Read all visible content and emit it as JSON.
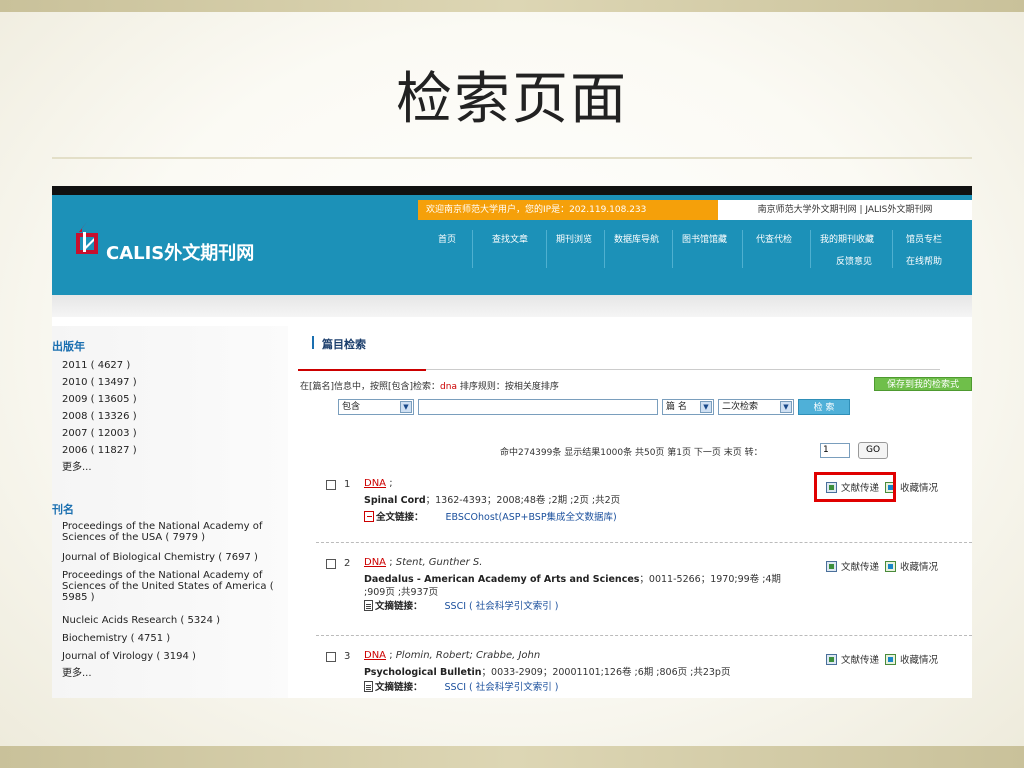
{
  "slide": {
    "title": "检索页面"
  },
  "header": {
    "welcome": "欢迎南京师范大学用户，您的IP是：202.119.108.233",
    "site_name": "南京师范大学外文期刊网 | JALIS外文期刊网",
    "logo_text": "CALIS外文期刊网",
    "nav": [
      "首页",
      "查找文章",
      "期刊浏览",
      "数据库导航",
      "图书馆馆藏",
      "代查代检",
      "我的期刊收藏",
      "馆员专栏"
    ],
    "nav_row2": [
      "反馈意见",
      "在线帮助"
    ]
  },
  "sidebar": {
    "year_heading": "出版年",
    "years": [
      "2011 ( 4627 )",
      "2010 ( 13497 )",
      "2009 ( 13605 )",
      "2008 ( 13326 )",
      "2007 ( 12003 )",
      "2006 ( 11827 )"
    ],
    "years_more": "更多...",
    "journal_heading": "刊名",
    "journals": [
      "Proceedings of the National Academy of Sciences of the USA ( 7979 )",
      "Journal of Biological Chemistry ( 7697 )",
      "Proceedings of the National Academy of Sciences of the United States of America ( 5985 )",
      "Nucleic Acids Research ( 5324 )",
      "Biochemistry ( 4751 )",
      "Journal of Virology ( 3194 )"
    ],
    "journals_more": "更多..."
  },
  "main": {
    "section_title": "篇目检索",
    "info_prefix": "在[篇名]信息中，按照[包含]检索：",
    "keyword": "dna",
    "info_suffix": " 排序规则：按相关度排序",
    "save_button": "保存到我的检索式",
    "match_select": "包含",
    "field_select": "篇 名",
    "secondary_select": "二次检索",
    "search_button": "检 索",
    "stats": "命中274399条 显示结果1000条 共50页 第1页 下一页 末页 转：",
    "page_input": "1",
    "go_button": "GO"
  },
  "results": [
    {
      "num": "1",
      "title": "DNA",
      "authors": "",
      "journal": "Spinal Cord",
      "details": "；1362-4393；2008;48卷 ;2期 ;2页 ;共2页",
      "details2": "",
      "link_label": "全文链接：",
      "link_source": "EBSCOhost(ASP+BSP集成全文数据库)",
      "action1": "文献传递",
      "action2": "收藏情况"
    },
    {
      "num": "2",
      "title": "DNA",
      "authors": "Stent, Gunther S.",
      "journal": "Daedalus - American Academy of Arts and Sciences",
      "details": "；0011-5266；1970;99卷 ;4期",
      "details2": ";909页 ;共937页",
      "link_label": "文摘链接：",
      "link_source": "SSCI ( 社会科学引文索引 )",
      "action1": "文献传递",
      "action2": "收藏情况"
    },
    {
      "num": "3",
      "title": "DNA",
      "authors": "Plomin, Robert; Crabbe, John",
      "journal": "Psychological Bulletin",
      "details": "；0033-2909；20001101;126卷 ;6期 ;806页 ;共23p页",
      "details2": "",
      "link_label": "文摘链接：",
      "link_source": "SSCI ( 社会科学引文索引 )",
      "action1": "文献传递",
      "action2": "收藏情况"
    }
  ],
  "colors": {
    "header_blue": "#1c91b8",
    "welcome_orange": "#f5a00a",
    "highlight_red": "#e00000",
    "save_green": "#6fbf4a"
  }
}
